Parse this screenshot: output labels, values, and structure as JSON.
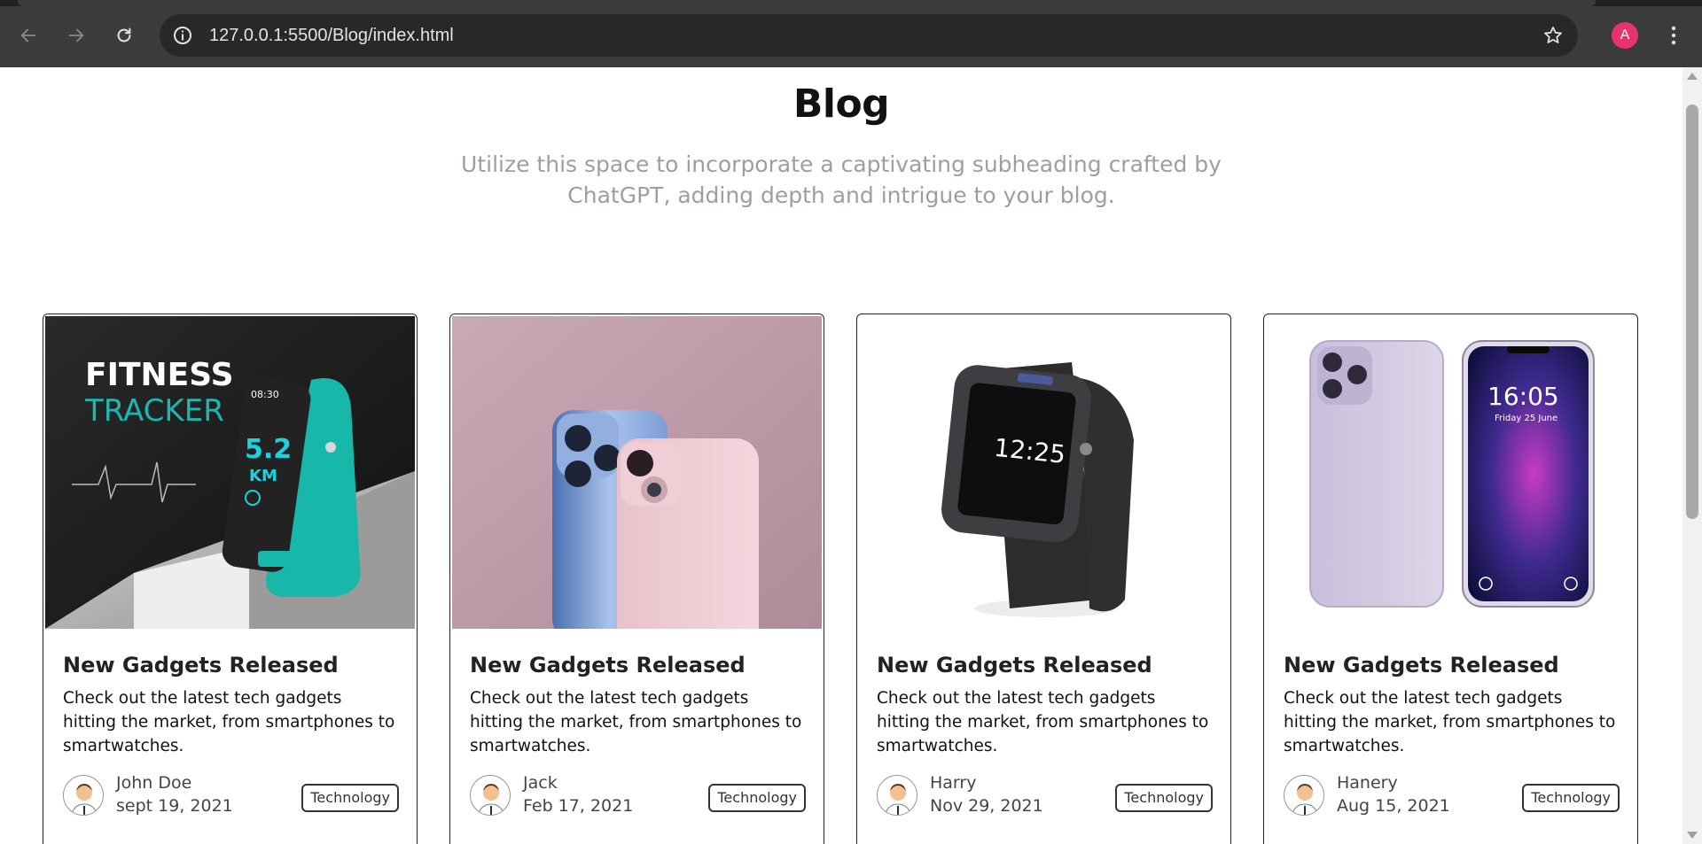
{
  "browser": {
    "url": "127.0.0.1:5500/Blog/index.html",
    "profile_initial": "A",
    "profile_color": "#e8336e",
    "icons": [
      "back-arrow-icon",
      "forward-arrow-icon",
      "reload-icon",
      "info-icon",
      "star-icon",
      "kebab-menu-icon"
    ]
  },
  "page": {
    "title": "Blog",
    "subtitle": "Utilize this space to incorporate a captivating subheading crafted by ChatGPT, adding depth and intrigue to your blog."
  },
  "cards": [
    {
      "image": "fitness-tracker-image",
      "image_text_1": "FITNESS",
      "image_text_2": "TRACKER",
      "image_time": "08:30",
      "image_distance": "5.2",
      "image_unit": "KM",
      "title": "New Gadgets Released",
      "description": "Check out the latest tech gadgets hitting the market, from smartphones to smartwatches.",
      "author": "John Doe",
      "date": "sept 19, 2021",
      "tag": "Technology"
    },
    {
      "image": "smartphones-image",
      "title": "New Gadgets Released",
      "description": "Check out the latest tech gadgets hitting the market, from smartphones to smartwatches.",
      "author": "Jack",
      "date": "Feb 17, 2021",
      "tag": "Technology"
    },
    {
      "image": "smartwatch-image",
      "image_time": "12:25",
      "title": "New Gadgets Released",
      "description": "Check out the latest tech gadgets hitting the market, from smartphones to smartwatches.",
      "author": "Harry",
      "date": "Nov 29, 2021",
      "tag": "Technology"
    },
    {
      "image": "phone-front-back-image",
      "image_time": "16:05",
      "image_date": "Friday 25 June",
      "title": "New Gadgets Released",
      "description": "Check out the latest tech gadgets hitting the market, from smartphones to smartwatches.",
      "author": "Hanery",
      "date": "Aug 15, 2021",
      "tag": "Technology"
    }
  ]
}
